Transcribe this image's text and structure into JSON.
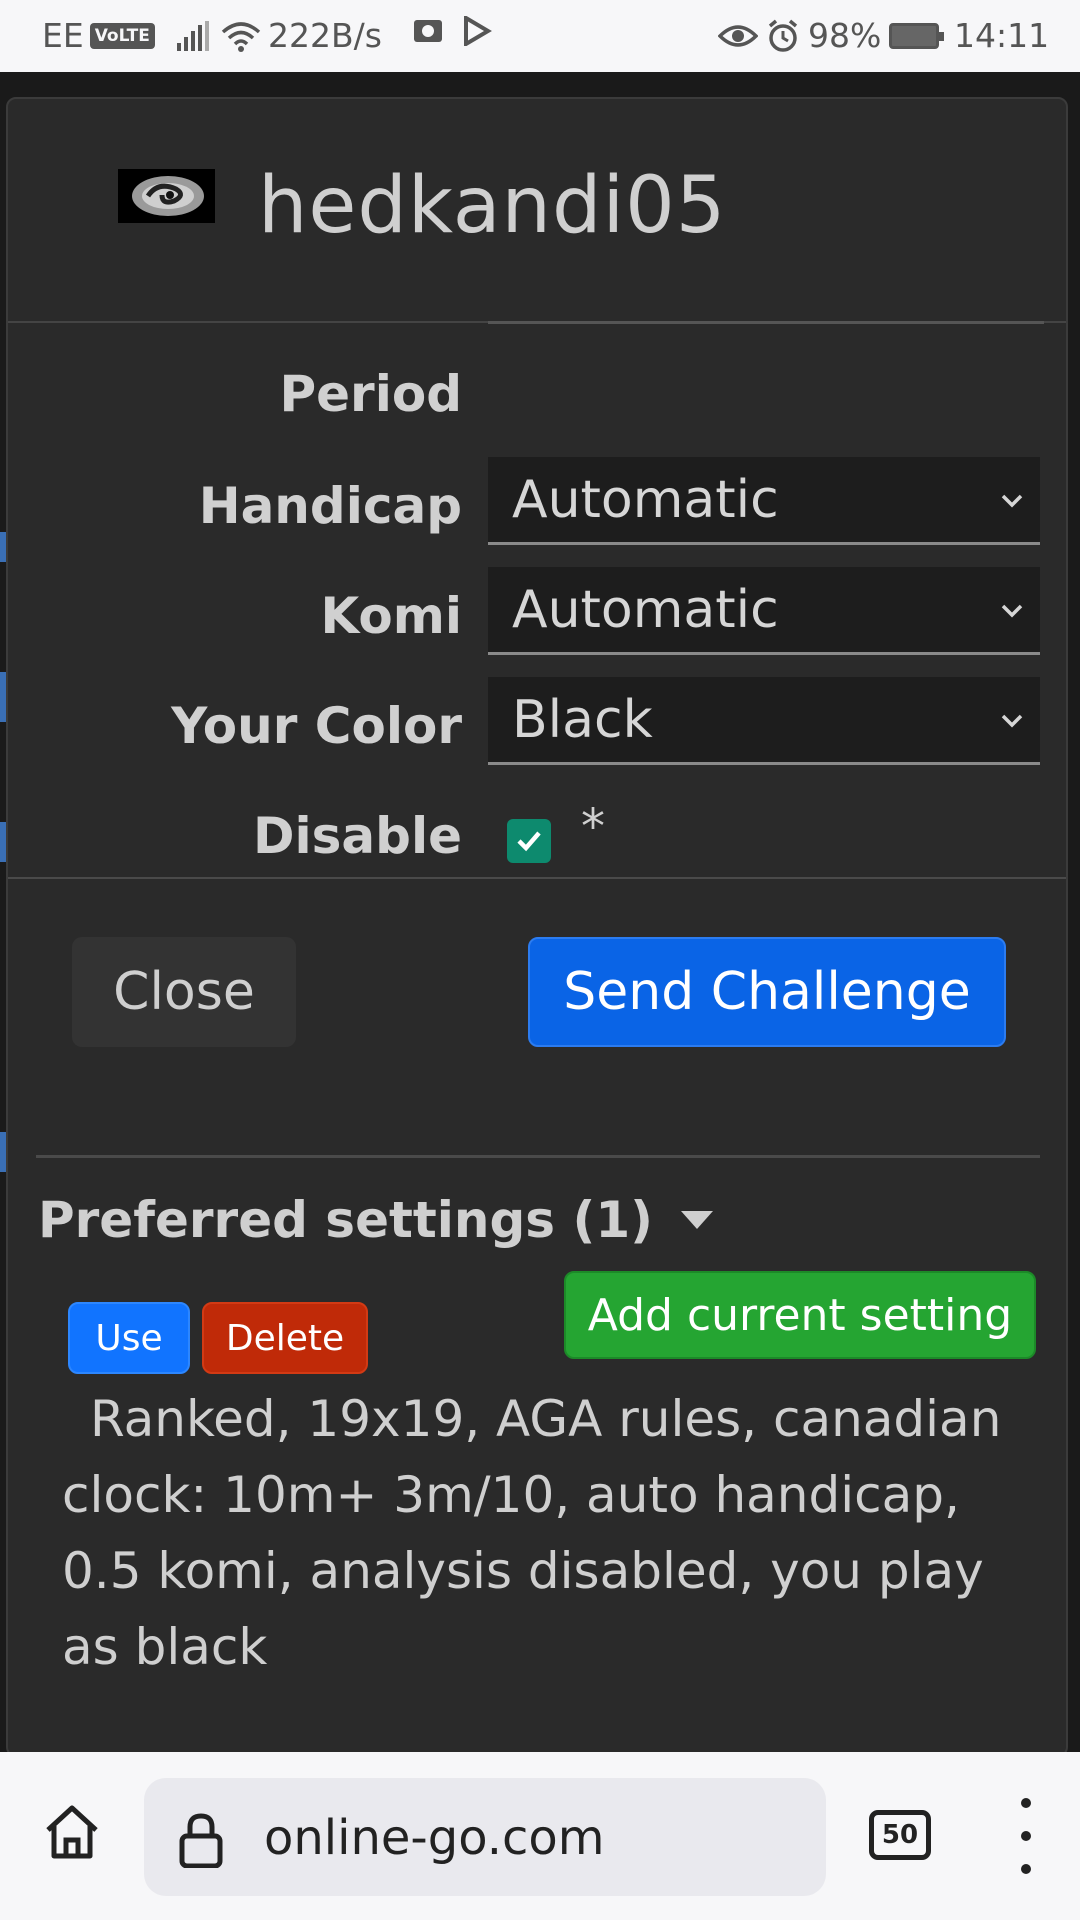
{
  "status_bar": {
    "carrier": "EE",
    "volte": "VoLTE",
    "speed": "222B/s",
    "battery": "98%",
    "time": "14:11"
  },
  "modal": {
    "username": "hedkandi05",
    "rows": {
      "period_label": "Period",
      "handicap_label": "Handicap",
      "handicap_value": "Automatic",
      "komi_label": "Komi",
      "komi_value": "Automatic",
      "color_label": "Your Color",
      "color_value": "Black",
      "disable_label": "Disable",
      "disable_checked": true,
      "disable_note": "*"
    },
    "buttons": {
      "close": "Close",
      "send": "Send Challenge"
    },
    "preferred": {
      "title": "Preferred settings (1)",
      "add": "Add current setting",
      "use": "Use",
      "delete": "Delete",
      "description": "Ranked, 19x19, AGA rules, canadian clock: 10m+ 3m/10, auto handicap, 0.5 komi, analysis disabled, you play as black"
    }
  },
  "browser": {
    "url": "online-go.com",
    "tab_count": "50"
  },
  "colors": {
    "primary": "#0a64e6",
    "success": "#25a532",
    "danger": "#c02a08",
    "checkbox": "#0d8a6e"
  }
}
